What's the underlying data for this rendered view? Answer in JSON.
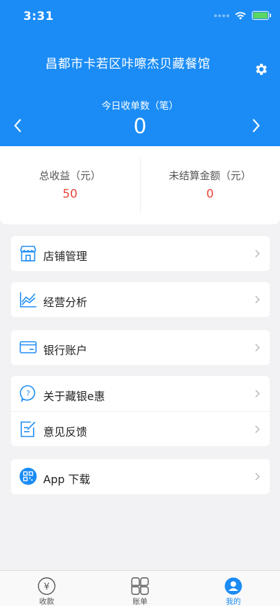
{
  "status": {
    "time": "3:31"
  },
  "header": {
    "store_name": "昌都市卡若区咔嚓杰贝藏餐馆",
    "orders_label": "今日收单数（笔）",
    "orders_count": "0"
  },
  "summary": {
    "total_label": "总收益（元）",
    "total_value": "50",
    "unsettled_label": "未结算金额（元）",
    "unsettled_value": "0"
  },
  "menu": {
    "store_manage": "店铺管理",
    "business_analysis": "经营分析",
    "bank_account": "银行账户",
    "about": "关于藏银e惠",
    "feedback": "意见反馈",
    "app_download": "App 下载"
  },
  "tabs": {
    "collect": "收款",
    "bills": "账单",
    "mine": "我的"
  },
  "colors": {
    "brand_blue": "#1b8cf5",
    "value_red": "#e8443a"
  }
}
